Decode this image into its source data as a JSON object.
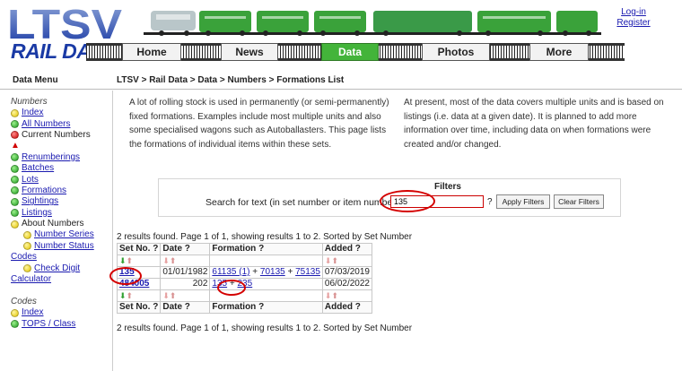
{
  "header": {
    "logo_letters": "LTSV",
    "logo_text": "RAIL DATA",
    "nav": [
      "Home",
      "News",
      "Data",
      "Photos",
      "More"
    ],
    "active_nav": "Data",
    "login_link": "Log-in",
    "register_link": "Register"
  },
  "subbar": {
    "menu_title": "Data Menu",
    "breadcrumb": "LTSV > Rail Data > Data > Numbers > Formations List"
  },
  "sidebar": {
    "numbers_heading": "Numbers",
    "items": [
      {
        "label": "Index",
        "dot": "yellow",
        "link": true
      },
      {
        "label": "All Numbers",
        "dot": "green",
        "link": true
      },
      {
        "label": "Current Numbers",
        "dot": "red",
        "link": false
      },
      {
        "label": "",
        "dot": "warning",
        "link": false
      },
      {
        "label": "Renumberings",
        "dot": "green",
        "link": true
      },
      {
        "label": "Batches",
        "dot": "green",
        "link": true
      },
      {
        "label": "Lots",
        "dot": "green",
        "link": true
      },
      {
        "label": "Formations",
        "dot": "green",
        "link": true
      },
      {
        "label": "Sightings",
        "dot": "green",
        "link": true
      },
      {
        "label": "Listings",
        "dot": "green",
        "link": true
      },
      {
        "label": "About Numbers",
        "dot": "yellow",
        "link": false
      },
      {
        "label": "Number Series",
        "dot": "yellow",
        "link": true,
        "indent": true
      },
      {
        "label": "Number Status",
        "dot": "yellow",
        "link": true,
        "indent": true
      },
      {
        "label": "Codes",
        "dot": "none",
        "link": true
      },
      {
        "label": "Check Digit",
        "dot": "yellow",
        "link": true,
        "indent": true
      },
      {
        "label": "Calculator",
        "dot": "none",
        "link": true
      }
    ],
    "codes_heading": "Codes",
    "codes_items": [
      {
        "label": "Index",
        "dot": "yellow",
        "link": true
      },
      {
        "label": "TOPS / Class",
        "dot": "green",
        "link": true
      }
    ]
  },
  "intro": {
    "left": "A lot of rolling stock is used in permanently (or semi-permanently) fixed formations. Examples include most multiple units and also some specialised wagons such as Autoballasters. This page lists the formations of individual items within these sets.",
    "right": "At present, most of the data covers multiple units and is based on listings (i.e. data at a given date). It is planned to add more information over time, including data on when formations were created and/or changed."
  },
  "filters": {
    "title": "Filters",
    "label": "Search for text (in set number or item numbers):",
    "value": "135",
    "help": "?",
    "apply": "Apply Filters",
    "clear": "Clear Filters"
  },
  "results_text": "2 results found. Page 1 of 1, showing results 1 to 2. Sorted by Set Number",
  "table": {
    "headers": [
      "Set No. ?",
      "Date ?",
      "Formation ?",
      "Added ?"
    ],
    "rows": [
      {
        "set": "135",
        "date": "01/01/1982",
        "formation": [
          "61135 (1)",
          "70135",
          "75135"
        ],
        "added": "07/03/2019"
      },
      {
        "set": "484005",
        "date": "202",
        "formation": [
          "135",
          "235"
        ],
        "added": "06/02/2022"
      }
    ]
  },
  "colors": {
    "accent": "#43b43a",
    "link": "#1a1ab0",
    "logo": "#1a3aa5",
    "highlight": "#d40000"
  }
}
